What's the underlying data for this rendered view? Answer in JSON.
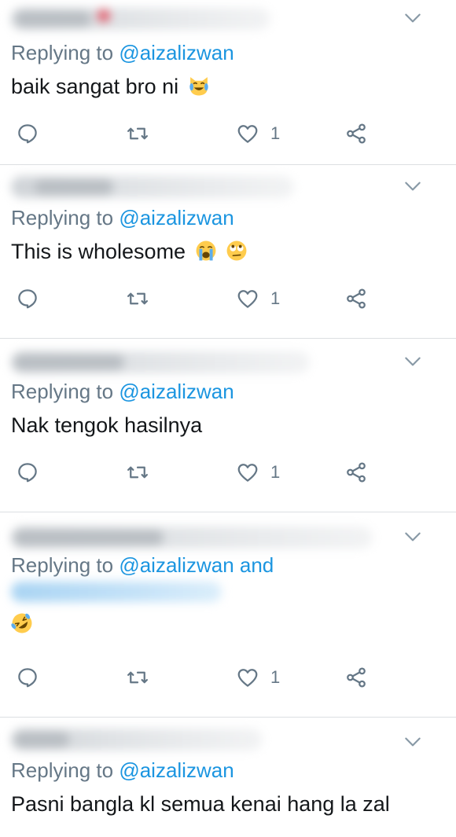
{
  "replies": [
    {
      "reply_prefix": "Replying to ",
      "mention": "@aizalizwan",
      "text": "baik sangat bro ni",
      "emojis": [
        "joy-cat-emoji"
      ],
      "likes": "1"
    },
    {
      "reply_prefix": "Replying to ",
      "mention": "@aizalizwan",
      "text": "This is wholesome",
      "emojis": [
        "loudly-crying-emoji",
        "rolling-eyes-emoji"
      ],
      "likes": "1"
    },
    {
      "reply_prefix": "Replying to ",
      "mention": "@aizalizwan",
      "text": "Nak tengok hasilnya",
      "emojis": [],
      "likes": "1"
    },
    {
      "reply_prefix": "Replying to ",
      "mention": "@aizalizwan",
      "mention_suffix": " and",
      "text": "",
      "emojis": [
        "rofl-emoji"
      ],
      "likes": "1"
    },
    {
      "reply_prefix": "Replying to ",
      "mention": "@aizalizwan",
      "text": "Pasni bangla kl semua kenai hang la zal",
      "emojis": []
    }
  ],
  "colors": {
    "mention": "#1b95e0",
    "muted": "#657786",
    "text": "#14171a",
    "divider": "#dcdfe2"
  }
}
